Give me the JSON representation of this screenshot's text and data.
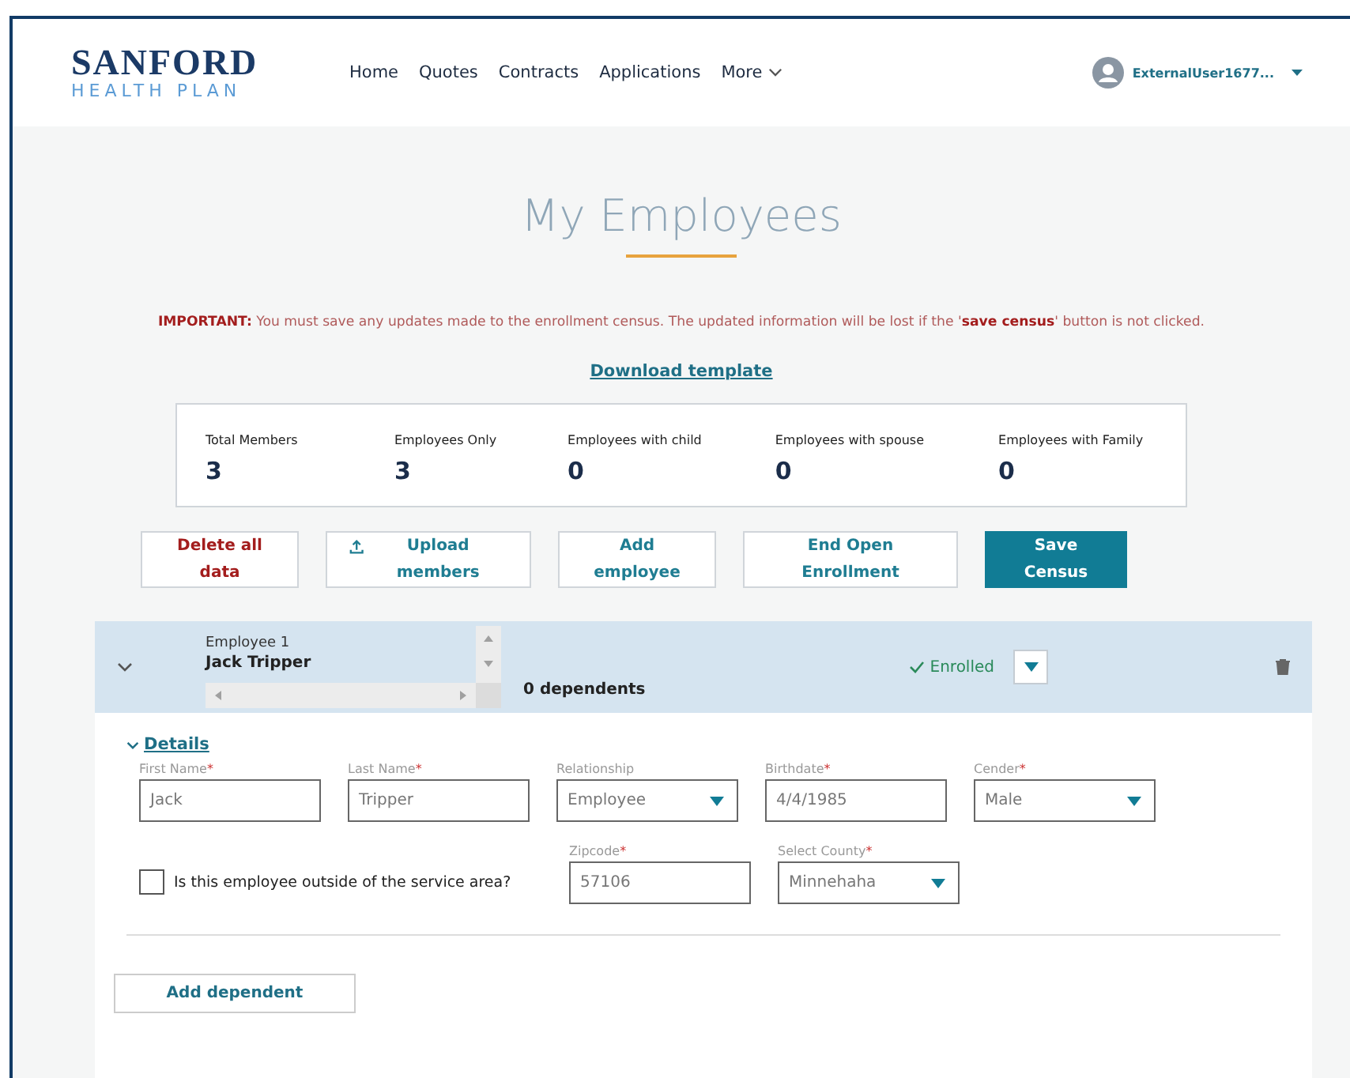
{
  "header": {
    "logo_top": "SANFORD",
    "logo_bottom": "HEALTH PLAN",
    "nav": [
      {
        "label": "Home",
        "dropdown": false
      },
      {
        "label": "Quotes",
        "dropdown": false
      },
      {
        "label": "Contracts",
        "dropdown": false
      },
      {
        "label": "Applications",
        "dropdown": false
      },
      {
        "label": "More",
        "dropdown": true
      }
    ],
    "user": "ExternalUser1677..."
  },
  "title": "My Employees",
  "notice": {
    "label": "IMPORTANT:",
    "text": "You must save any updates made to the enrollment census. The updated information will be lost if the '**save census**' button is not clicked."
  },
  "download_link": "Download template",
  "stats": [
    {
      "label": "Total Members",
      "value": "3"
    },
    {
      "label": "Employees Only",
      "value": "3"
    },
    {
      "label": "Employees with child",
      "value": "0"
    },
    {
      "label": "Employees with spouse",
      "value": "0"
    },
    {
      "label": "Employees with Family",
      "value": "0"
    }
  ],
  "actions": [
    {
      "label": "Delete all data",
      "kind": "danger"
    },
    {
      "label": "Upload members",
      "kind": "upload"
    },
    {
      "label": "Add employee",
      "kind": "plain"
    },
    {
      "label": "End Open Enrollment",
      "kind": "plain"
    },
    {
      "label": "Save Census",
      "kind": "primary"
    }
  ],
  "employee": {
    "expanded": true,
    "heading": "Employee 1",
    "name": "Jack Tripper",
    "dependents": "0 dependents",
    "status": "Enrolled",
    "details": {
      "link": "Details",
      "expanded": true,
      "fields": [
        {
          "label": "First Name",
          "required_mark": "*",
          "value": "Jack",
          "kind": "text"
        },
        {
          "label": "Last Name",
          "required_mark": "*",
          "value": "Tripper",
          "kind": "text"
        },
        {
          "label": "Relationship",
          "value": "Employee",
          "kind": "select"
        },
        {
          "label": "Birthdate",
          "required_mark": "*",
          "value": "4/4/1985",
          "kind": "text"
        },
        {
          "label": "Cender",
          "required_mark": "*",
          "value": "Male",
          "kind": "select"
        }
      ],
      "outside_area": {
        "label": "Is this employee outside of the service area?",
        "checked": false
      },
      "location_fields": [
        {
          "label": "Zipcode",
          "required_mark": "*",
          "value": "57106",
          "kind": "text"
        },
        {
          "label": "Select County",
          "required_mark": "*",
          "value": "Minnehaha",
          "kind": "select"
        }
      ]
    },
    "add_dependent": "Add dependent"
  }
}
